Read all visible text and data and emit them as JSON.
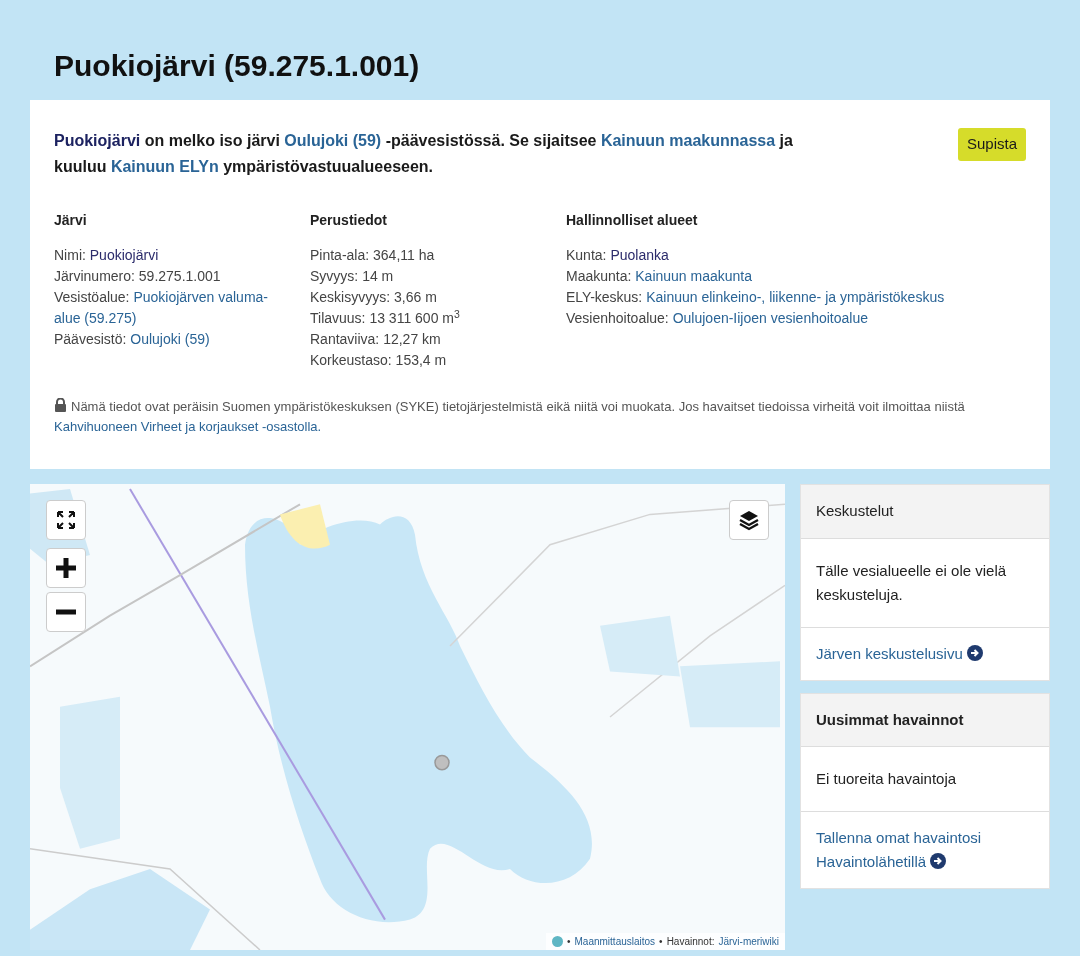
{
  "title": "Puokiojärvi (59.275.1.001)",
  "intro": [
    {
      "kind": "name",
      "text": "Puokiojärvi"
    },
    {
      "kind": "text",
      "text": " on melko iso järvi "
    },
    {
      "kind": "link",
      "text": "Oulujoki (59)"
    },
    {
      "kind": "text",
      "text": " -päävesistössä. Se sijaitsee "
    },
    {
      "kind": "link",
      "text": "Kainuun maakunnassa"
    },
    {
      "kind": "text",
      "text": " ja kuuluu "
    },
    {
      "kind": "link",
      "text": "Kainuun ELYn"
    },
    {
      "kind": "text",
      "text": " ympäristövastuualueeseen."
    }
  ],
  "collapse_button": "Supista",
  "columns": [
    {
      "heading": "Järvi",
      "rows": [
        {
          "label": "Nimi:",
          "value": "Puokiojärvi",
          "kind": "plain"
        },
        {
          "label": "Järvinumero:",
          "value": "59.275.1.001",
          "kind": "text"
        },
        {
          "label": "Vesistöalue:",
          "value": "Puokiojärven valuma-alue (59.275)",
          "kind": "link"
        },
        {
          "label": "Päävesistö:",
          "value": "Oulujoki (59)",
          "kind": "link"
        }
      ]
    },
    {
      "heading": "Perustiedot",
      "rows": [
        {
          "label": "Pinta-ala:",
          "value": "364,11 ha",
          "kind": "text"
        },
        {
          "label": "Syvyys:",
          "value": "14 m",
          "kind": "text"
        },
        {
          "label": "Keskisyvyys:",
          "value": "3,66 m",
          "kind": "text"
        },
        {
          "label": "Tilavuus:",
          "value": "13 311 600 m$^{3}$",
          "kind": "text"
        },
        {
          "label": "Rantaviiva:",
          "value": "12,27 km",
          "kind": "text"
        },
        {
          "label": "Korkeustaso:",
          "value": "153,4 m",
          "kind": "text"
        }
      ]
    },
    {
      "heading": "Hallinnolliset alueet",
      "rows": [
        {
          "label": "Kunta:",
          "value": "Puolanka",
          "kind": "plain"
        },
        {
          "label": "Maakunta:",
          "value": "Kainuun maakunta",
          "kind": "link"
        },
        {
          "label": "ELY-keskus:",
          "value": "Kainuun elinkeino-, liikenne- ja ympäristökeskus",
          "kind": "link"
        },
        {
          "label": "Vesienhoitoalue:",
          "value": "Oulujoen-Iijoen vesienhoitoalue",
          "kind": "link"
        }
      ]
    }
  ],
  "notice": {
    "text": "Nämä tiedot ovat peräisin Suomen ympäristökeskuksen (SYKE) tietojärjestelmistä eikä niitä voi muokata. Jos havaitset tiedoissa virheitä voit ilmoittaa niistä ",
    "link": "Kahvihuoneen Virheet ja korjaukset -osastolla."
  },
  "map": {
    "attribution": [
      {
        "kind": "sep",
        "text": "•"
      },
      {
        "kind": "link",
        "text": "Maanmittauslaitos"
      },
      {
        "kind": "sep",
        "text": "•"
      },
      {
        "kind": "text",
        "text": "Havainnot:"
      },
      {
        "kind": "link",
        "text": "Järvi-meriwiki"
      }
    ]
  },
  "sidebar": [
    {
      "heading": "Keskustelut",
      "heading_bold": false,
      "body": "Tälle vesialueelle ei ole vielä keskusteluja.",
      "link": "Järven keskustelusivu"
    },
    {
      "heading": "Uusimmat havainnot",
      "heading_bold": true,
      "body": "Ei tuoreita havaintoja",
      "link": "Tallenna omat havaintosi Havaintolähetillä"
    }
  ]
}
